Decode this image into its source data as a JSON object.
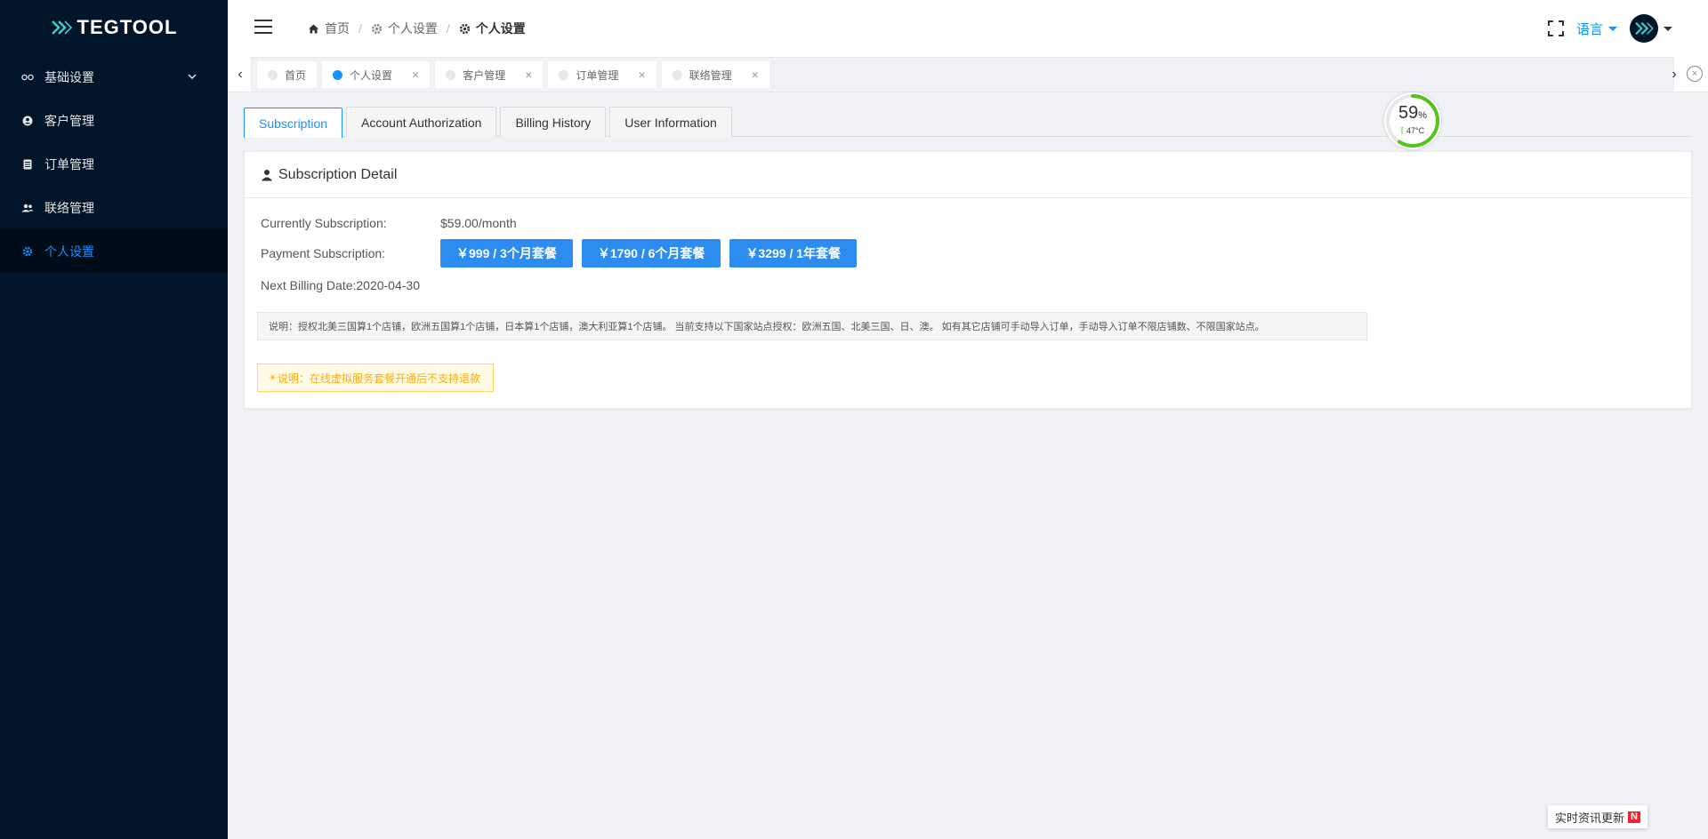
{
  "app": {
    "brand": "TEGTOOL"
  },
  "sidebar": {
    "items": [
      {
        "label": "基础设置",
        "icon": "infinity-icon",
        "has_children": true
      },
      {
        "label": "客户管理",
        "icon": "user-circle-icon"
      },
      {
        "label": "订单管理",
        "icon": "document-icon"
      },
      {
        "label": "联络管理",
        "icon": "users-icon"
      },
      {
        "label": "个人设置",
        "icon": "gear-icon",
        "active": true
      }
    ]
  },
  "header": {
    "breadcrumb": [
      {
        "label": "首页",
        "icon": "home-icon"
      },
      {
        "label": "个人设置",
        "icon": "gear-icon"
      },
      {
        "label": "个人设置",
        "icon": "gear-icon"
      }
    ],
    "language_label": "语言"
  },
  "tabs": [
    {
      "label": "首页",
      "active": false,
      "closable": false
    },
    {
      "label": "个人设置",
      "active": true,
      "closable": true
    },
    {
      "label": "客户管理",
      "active": false,
      "closable": true
    },
    {
      "label": "订单管理",
      "active": false,
      "closable": true
    },
    {
      "label": "联络管理",
      "active": false,
      "closable": true
    }
  ],
  "sub_tabs": [
    {
      "label": "Subscription",
      "active": true
    },
    {
      "label": "Account Authorization"
    },
    {
      "label": "Billing History"
    },
    {
      "label": "User Information"
    }
  ],
  "card": {
    "title": "Subscription Detail",
    "current_label": "Currently Subscription:",
    "current_value": "$59.00/month",
    "payment_label": "Payment Subscription:",
    "plans": [
      {
        "label": "￥999 / 3个月套餐"
      },
      {
        "label": "￥1790 / 6个月套餐"
      },
      {
        "label": "￥3299 / 1年套餐"
      }
    ],
    "next_billing": "Next Billing Date:2020-04-30",
    "note": "说明：授权北美三国算1个店铺，欧洲五国算1个店铺，日本算1个店铺，澳大利亚算1个店铺。 当前支持以下国家站点授权：欧洲五国、北美三国、日、澳。 如有其它店铺可手动导入订单，手动导入订单不限店铺数、不限国家站点。",
    "warning": "说明：在线虚拟服务套餐开通后不支持退款"
  },
  "gauge": {
    "percent": "59",
    "percent_unit": "%",
    "temp": "47°C",
    "fraction": 0.59,
    "color": "#52c41a"
  },
  "news": {
    "label": "实时资讯更新",
    "badge": "N"
  },
  "colors": {
    "sidebar_bg": "#001529",
    "accent": "#1890ff",
    "button": "#2d8cf0"
  }
}
